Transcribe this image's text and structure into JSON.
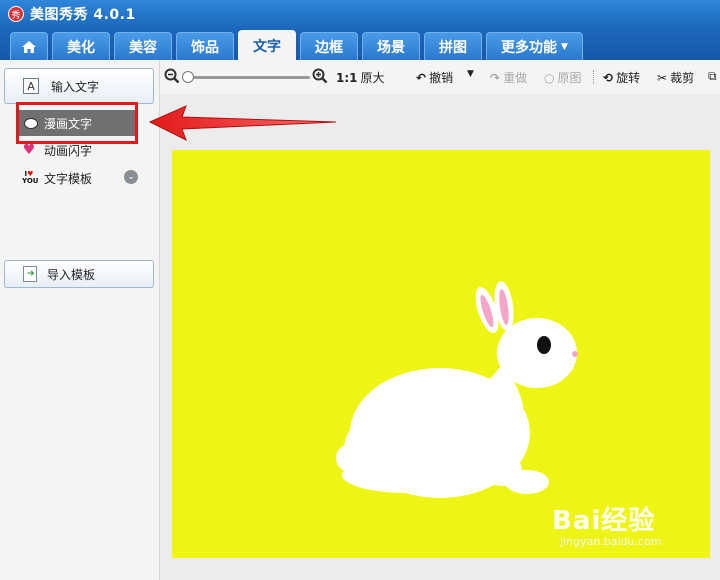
{
  "app": {
    "title": "美图秀秀 4.0.1",
    "logo_text": "秀"
  },
  "tabs": [
    {
      "label": "美化"
    },
    {
      "label": "美容"
    },
    {
      "label": "饰品"
    },
    {
      "label": "文字"
    },
    {
      "label": "边框"
    },
    {
      "label": "场景"
    },
    {
      "label": "拼图"
    },
    {
      "label": "更多功能"
    }
  ],
  "active_tab": "文字",
  "sidebar": {
    "input_text_button": "输入文字",
    "items": [
      {
        "label": "漫画文字",
        "icon": "speech-bubble-icon",
        "selected": true
      },
      {
        "label": "动画闪字",
        "icon": "heart-icon"
      },
      {
        "label": "文字模板",
        "icon": "i-love-you-icon"
      }
    ],
    "import_button": "导入模板"
  },
  "toolbar": {
    "ratio_label": "1:1",
    "original_size": "原大",
    "undo": "撤销",
    "redo": "重做",
    "original_image": "原图",
    "rotate": "旋转",
    "crop": "裁剪"
  },
  "watermark": {
    "brand": "Bai经验",
    "url": "jingyan.baidu.com"
  },
  "colors": {
    "title_bar": "#1b68bd",
    "photo_background": "#eef414",
    "highlight": "#e01a1a"
  }
}
